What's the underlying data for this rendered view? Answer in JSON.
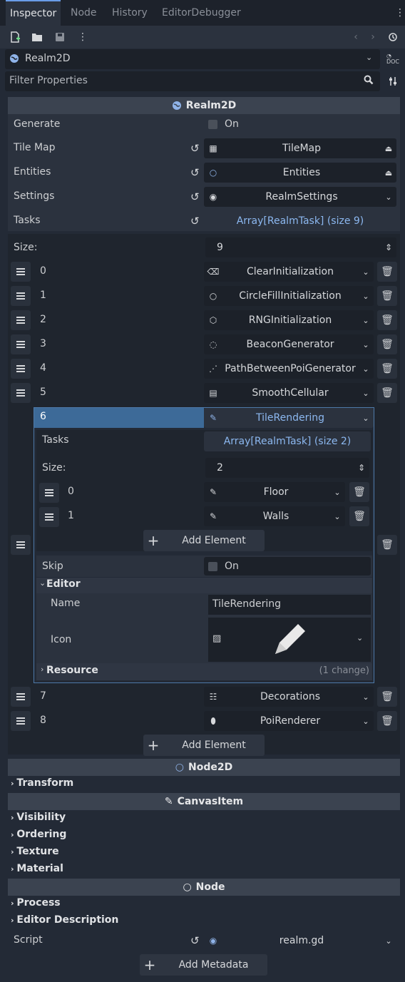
{
  "tabs": [
    "Inspector",
    "Node",
    "History",
    "EditorDebugger"
  ],
  "object_selector": "Realm2D",
  "filter_placeholder": "Filter Properties",
  "sections": {
    "realm2d": "Realm2D",
    "node2d": "Node2D",
    "canvas_item": "CanvasItem",
    "node": "Node"
  },
  "props": {
    "generate": {
      "label": "Generate",
      "value": "On"
    },
    "tile_map": {
      "label": "Tile Map",
      "value": "TileMap"
    },
    "entities": {
      "label": "Entities",
      "value": "Entities"
    },
    "settings": {
      "label": "Settings",
      "value": "RealmSettings"
    },
    "tasks": {
      "label": "Tasks",
      "value": "Array[RealmTask] (size 9)"
    },
    "size": {
      "label": "Size:",
      "value": "9"
    }
  },
  "tasks": [
    {
      "index": "0",
      "name": "ClearInitialization",
      "icon": "clear-icon"
    },
    {
      "index": "1",
      "name": "CircleFillInitialization",
      "icon": "circle-icon"
    },
    {
      "index": "2",
      "name": "RNGInitialization",
      "icon": "dice-icon"
    },
    {
      "index": "3",
      "name": "BeaconGenerator",
      "icon": "beacon-icon"
    },
    {
      "index": "4",
      "name": "PathBetweenPoiGenerator",
      "icon": "path-icon"
    },
    {
      "index": "5",
      "name": "SmoothCellular",
      "icon": "cellular-icon"
    },
    {
      "index": "6",
      "name": "TileRendering",
      "icon": "pencil-icon"
    },
    {
      "index": "7",
      "name": "Decorations",
      "icon": "decorations-icon"
    },
    {
      "index": "8",
      "name": "PoiRenderer",
      "icon": "pin-icon"
    }
  ],
  "nested": {
    "tasks_label": "Tasks",
    "tasks_value": "Array[RealmTask] (size 2)",
    "size_label": "Size:",
    "size_value": "2",
    "items": [
      {
        "index": "0",
        "name": "Floor"
      },
      {
        "index": "1",
        "name": "Walls"
      }
    ],
    "add_element": "Add Element",
    "skip_label": "Skip",
    "skip_value": "On",
    "editor_group": "Editor",
    "name_label": "Name",
    "name_value": "TileRendering",
    "icon_label": "Icon",
    "resource_group": "Resource",
    "resource_changes": "(1 change)"
  },
  "add_element": "Add Element",
  "folds": {
    "transform": "Transform",
    "visibility": "Visibility",
    "ordering": "Ordering",
    "texture": "Texture",
    "material": "Material",
    "process": "Process",
    "editor_description": "Editor Description"
  },
  "script": {
    "label": "Script",
    "value": "realm.gd"
  },
  "add_metadata": "Add Metadata",
  "colors": {
    "accent": "#699ce8",
    "background": "#232a36",
    "selected_row": "#3d6a98"
  }
}
